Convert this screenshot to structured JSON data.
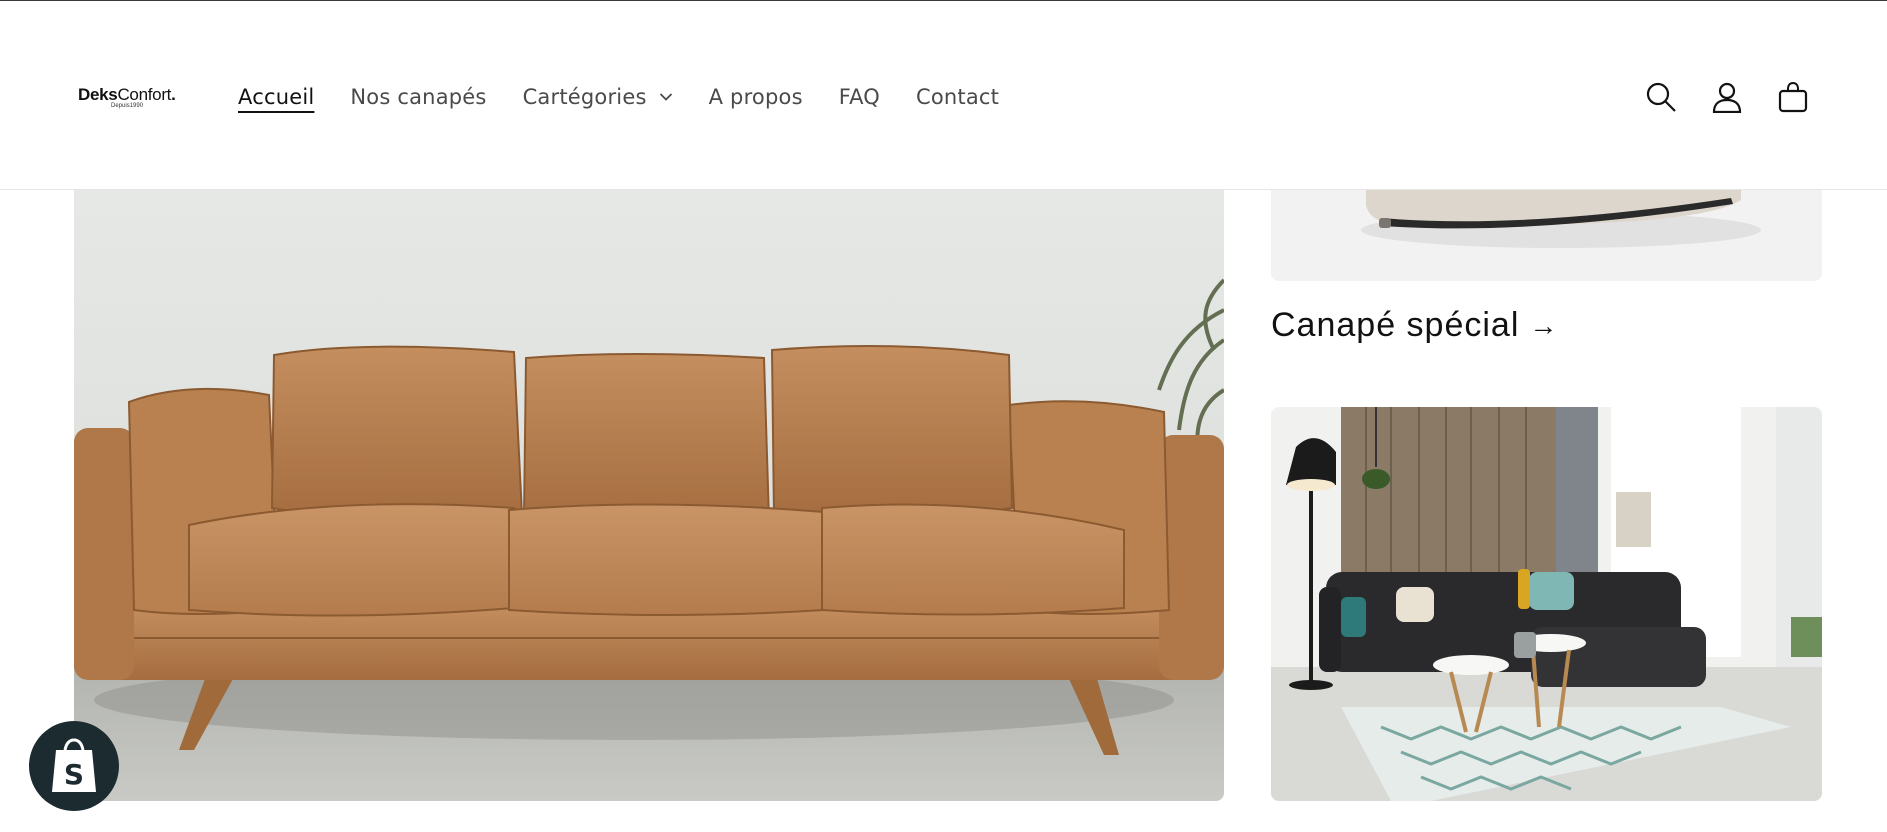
{
  "brand": {
    "logo_bold": "Deks",
    "logo_regular": "Confort",
    "logo_dot": ".",
    "logo_tagline": "Depuis1990"
  },
  "nav": {
    "items": [
      {
        "label": "Accueil",
        "active": true
      },
      {
        "label": "Nos canapés"
      },
      {
        "label": "Cartégories",
        "has_dropdown": true
      },
      {
        "label": "A propos"
      },
      {
        "label": "FAQ"
      },
      {
        "label": "Contact"
      }
    ]
  },
  "header_icons": [
    "search-icon",
    "account-icon",
    "cart-icon"
  ],
  "collections": {
    "featured_title": "Canapé spécial",
    "arrow": "→"
  },
  "colors": {
    "text": "#121212",
    "nav_text": "#4a4a4a",
    "card_bg": "#f2f2f2",
    "shopify_badge": "#1c2b30",
    "leather": "#b37a4a"
  }
}
